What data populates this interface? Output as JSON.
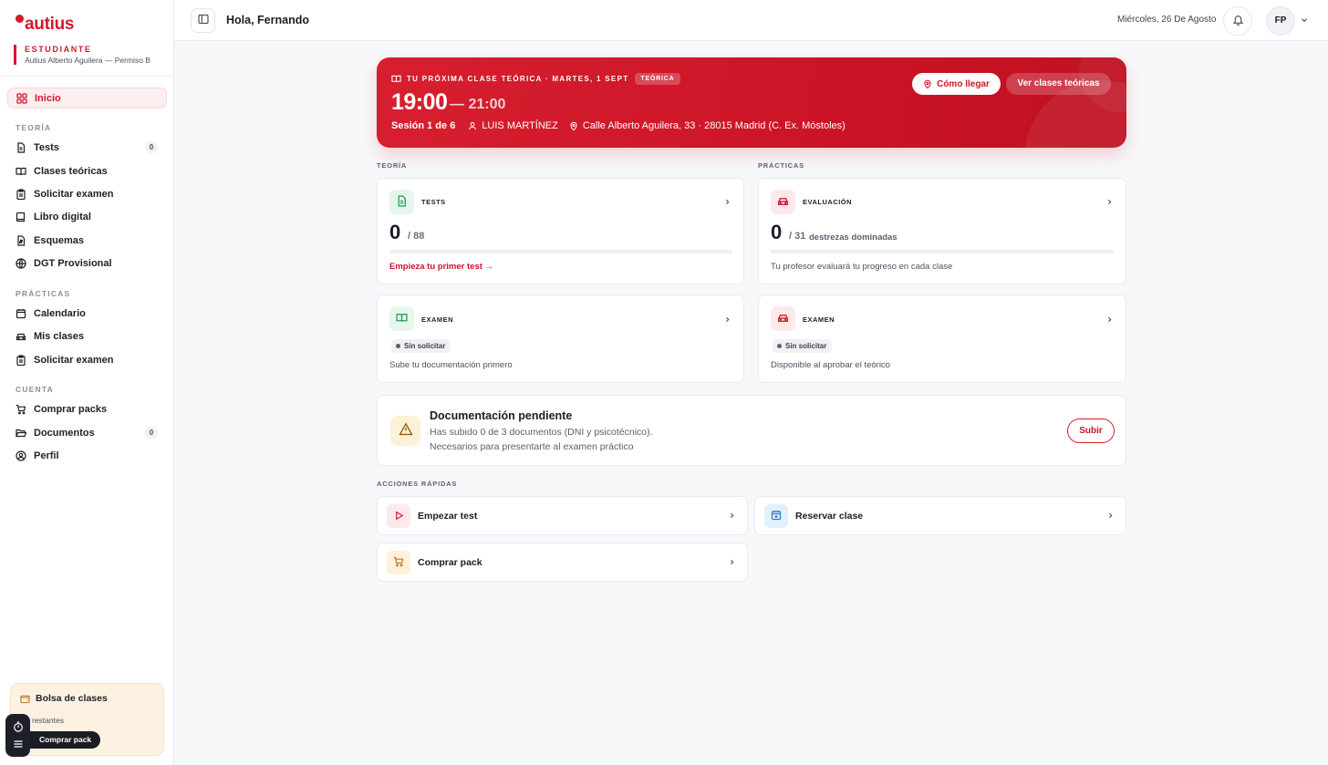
{
  "brand": {
    "name": "autius",
    "color": "#d3192b"
  },
  "sidebar": {
    "role": "ESTUDIANTE",
    "subtitle": "Autius Alberto Aguilera — Permiso B",
    "home": {
      "label": "Inicio"
    },
    "sections": {
      "teoria": "TEORÍA",
      "practicas": "PRÁCTICAS",
      "cuenta": "CUENTA"
    },
    "teoria_items": [
      {
        "label": "Tests",
        "count": "0"
      },
      {
        "label": "Clases teóricas"
      },
      {
        "label": "Solicitar examen"
      },
      {
        "label": "Libro digital"
      },
      {
        "label": "Esquemas"
      },
      {
        "label": "DGT Provisional"
      }
    ],
    "practicas_items": [
      {
        "label": "Calendario"
      },
      {
        "label": "Mis clases"
      },
      {
        "label": "Solicitar examen"
      }
    ],
    "cuenta_items": [
      {
        "label": "Comprar packs"
      },
      {
        "label": "Documentos",
        "count": "0"
      },
      {
        "label": "Perfil"
      }
    ],
    "bolsa": {
      "title": "Bolsa de clases",
      "remaining": "restantes",
      "button": "Comprar pack"
    }
  },
  "topbar": {
    "greeting": "Hola, Fernando",
    "date": "Miércoles, 26 De Agosto",
    "avatar_initials": "FP"
  },
  "hero": {
    "kicker": "TU PRÓXIMA CLASE TEÓRICA · MARTES, 1 SEPT",
    "badge": "TEÓRICA",
    "time_start": "19:00",
    "time_end": "— 21:00",
    "session": "Sesión 1 de 6",
    "instructor": "LUIS MARTÍNEZ",
    "address": "Calle Alberto Aguilera, 33 · 28015 Madrid (C. Ex. Móstoles)",
    "btn_directions": "Cómo llegar",
    "btn_classes": "Ver clases teóricas"
  },
  "main": {
    "teoria_label": "TEORÍA",
    "practicas_label": "PRÁCTICAS",
    "tests_card": {
      "label": "TESTS",
      "value": "0",
      "total": "/ 88",
      "progress": 0,
      "cta": "Empieza tu primer test →"
    },
    "eval_card": {
      "label": "EVALUACIÓN",
      "value": "0",
      "total": "/ 31",
      "suffix": "destrezas dominadas",
      "progress": 0,
      "note": "Tu profesor evaluará tu progreso en cada clase"
    },
    "exam_theory_card": {
      "label": "EXAMEN",
      "status": "Sin solicitar",
      "note": "Sube tu documentación primero"
    },
    "exam_practice_card": {
      "label": "EXAMEN",
      "status": "Sin solicitar",
      "note": "Disponible al aprobar el teórico"
    },
    "doc_card": {
      "title": "Documentación pendiente",
      "line1": "Has subido 0 de 3 documentos (DNI y psicotécnico).",
      "line2": "Necesarios para presentarte al examen práctico",
      "button": "Subir"
    },
    "quick_label": "ACCIONES RÁPIDAS",
    "quick_actions": [
      {
        "label": "Empezar test",
        "icon": "play-icon"
      },
      {
        "label": "Reservar clase",
        "icon": "calendar-plus-icon"
      },
      {
        "label": "Comprar pack",
        "icon": "cart-icon"
      }
    ]
  }
}
